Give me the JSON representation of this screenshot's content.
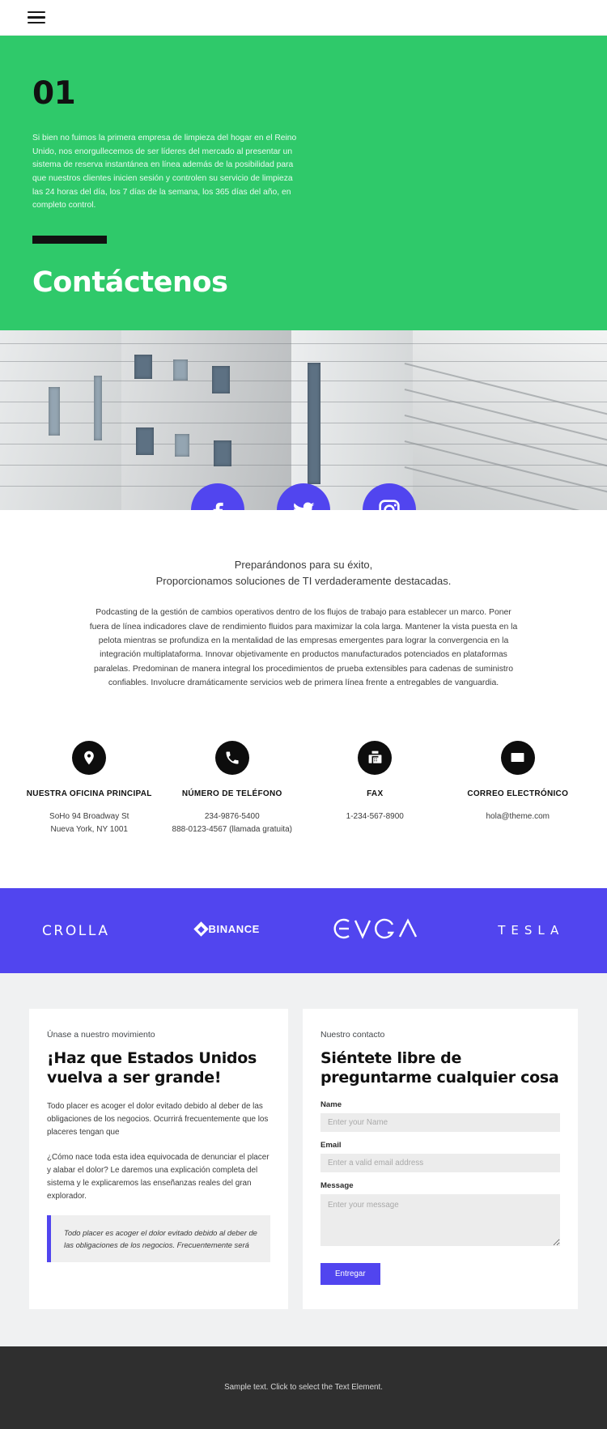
{
  "topbar": {
    "menu_icon": "hamburger-menu-icon"
  },
  "hero": {
    "number": "01",
    "paragraph": "Si bien no fuimos la primera empresa de limpieza del hogar en el Reino Unido, nos enorgullecemos de ser líderes del mercado al presentar un sistema de reserva instantánea en línea además de la posibilidad para que nuestros clientes inicien sesión y controlen su servicio de limpieza las 24 horas del día, los 7 días de la semana, los 365 días del año, en completo control.",
    "title": "Contáctenos",
    "bg_color": "#2fc96a"
  },
  "social": {
    "accent_color": "#5145ef",
    "items": [
      {
        "name": "facebook-icon",
        "label": "Facebook"
      },
      {
        "name": "twitter-icon",
        "label": "Twitter"
      },
      {
        "name": "instagram-icon",
        "label": "Instagram"
      }
    ]
  },
  "intro": {
    "lead_line1": "Preparándonos para su éxito,",
    "lead_line2": "Proporcionamos soluciones de TI verdaderamente destacadas.",
    "body": "Podcasting de la gestión de cambios operativos dentro de los flujos de trabajo para establecer un marco. Poner fuera de línea indicadores clave de rendimiento fluidos para maximizar la cola larga. Mantener la vista puesta en la pelota mientras se profundiza en la mentalidad de las empresas emergentes para lograr la convergencia en la integración multiplataforma. Innovar objetivamente en productos manufacturados potenciados en plataformas paralelas. Predominan de manera integral los procedimientos de prueba extensibles para cadenas de suministro confiables. Involucre dramáticamente servicios web de primera línea frente a entregables de vanguardia."
  },
  "contacts": [
    {
      "icon": "location-pin-icon",
      "title": "NUESTRA OFICINA PRINCIPAL",
      "value": "SoHo 94 Broadway St\nNueva York, NY 1001"
    },
    {
      "icon": "phone-icon",
      "title": "NÚMERO DE TELÉFONO",
      "value": "234-9876-5400\n888-0123-4567 (llamada gratuita)"
    },
    {
      "icon": "fax-icon",
      "title": "FAX",
      "value": "1-234-567-8900"
    },
    {
      "icon": "envelope-icon",
      "title": "CORREO ELECTRÓNICO",
      "value": "hola@theme.com"
    }
  ],
  "brands": {
    "bg_color": "#5145ef",
    "items": [
      {
        "name": "crolla-logo",
        "label": "CROLLA"
      },
      {
        "name": "binance-logo",
        "label": "BINANCE"
      },
      {
        "name": "evga-logo",
        "label": "EVGA"
      },
      {
        "name": "tesla-logo",
        "label": "TESLA"
      }
    ]
  },
  "left_card": {
    "eyebrow": "Únase a nuestro movimiento",
    "heading": "¡Haz que Estados Unidos vuelva a ser grande!",
    "paragraph1": "Todo placer es acoger el dolor evitado debido al deber de las obligaciones de los negocios. Ocurrirá frecuentemente que los placeres tengan que",
    "paragraph2": "¿Cómo nace toda esta idea equivocada de denunciar el placer y alabar el dolor? Le daremos una explicación completa del sistema y le explicaremos las enseñanzas reales del gran explorador.",
    "quote": "Todo placer es acoger el dolor evitado debido al deber de las obligaciones de los negocios. Frecuentemente será"
  },
  "form_card": {
    "eyebrow": "Nuestro contacto",
    "heading": "Siéntete libre de preguntarme cualquier cosa",
    "fields": [
      {
        "label": "Name",
        "placeholder": "Enter your Name",
        "value": ""
      },
      {
        "label": "Email",
        "placeholder": "Enter a valid email address",
        "value": ""
      },
      {
        "label": "Message",
        "placeholder": "Enter your message",
        "value": ""
      }
    ],
    "submit_label": "Entregar",
    "accent_color": "#5145ef"
  },
  "footer": {
    "text": "Sample text. Click to select the Text Element.",
    "bg_color": "#2f2f2f"
  }
}
